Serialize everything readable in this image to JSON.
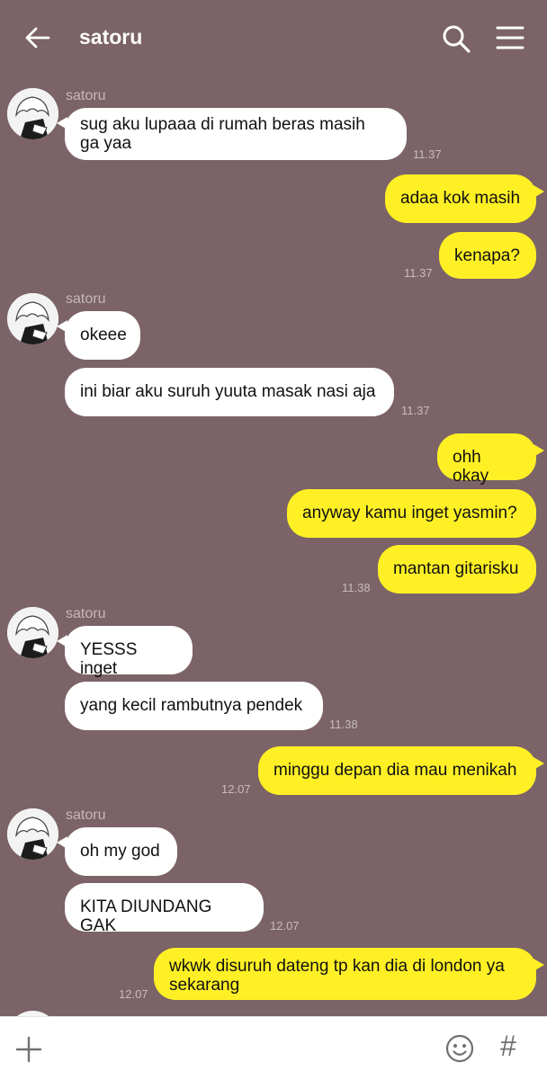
{
  "header": {
    "title": "satoru",
    "icons": [
      "back-arrow-icon",
      "search-icon",
      "menu-icon"
    ]
  },
  "colors": {
    "background": "#7b6367",
    "incoming_bubble": "#ffffff",
    "outgoing_bubble": "#fff025"
  },
  "messages": [
    {
      "from": "satoru",
      "text": "sug aku lupaaa di rumah beras masih\nga yaa",
      "time": "11.37"
    },
    {
      "from": "me",
      "text": "adaa kok masih"
    },
    {
      "from": "me",
      "text": "kenapa?",
      "time": "11.37"
    },
    {
      "from": "satoru",
      "text": "okeee"
    },
    {
      "from": "satoru",
      "text": "ini biar aku suruh yuuta masak nasi aja",
      "time": "11.37"
    },
    {
      "from": "me",
      "text": "ohh okay"
    },
    {
      "from": "me",
      "text": "anyway kamu inget yasmin?"
    },
    {
      "from": "me",
      "text": "mantan gitarisku",
      "time": "11.38"
    },
    {
      "from": "satoru",
      "text": "YESSS inget"
    },
    {
      "from": "satoru",
      "text": "yang kecil rambutnya pendek",
      "time": "11.38"
    },
    {
      "from": "me",
      "text": "minggu depan dia mau menikah",
      "time": "12.07"
    },
    {
      "from": "satoru",
      "text": "oh my god"
    },
    {
      "from": "satoru",
      "text": "KITA DIUNDANG GAK",
      "time": "12.07"
    },
    {
      "from": "me",
      "text": "wkwk disuruh dateng tp kan dia di london ya\nsekarang",
      "time": "12.07"
    }
  ],
  "input_bar": {
    "icons": [
      "plus-icon",
      "emoji-icon",
      "hashtag-icon"
    ],
    "hash_glyph": "#"
  }
}
